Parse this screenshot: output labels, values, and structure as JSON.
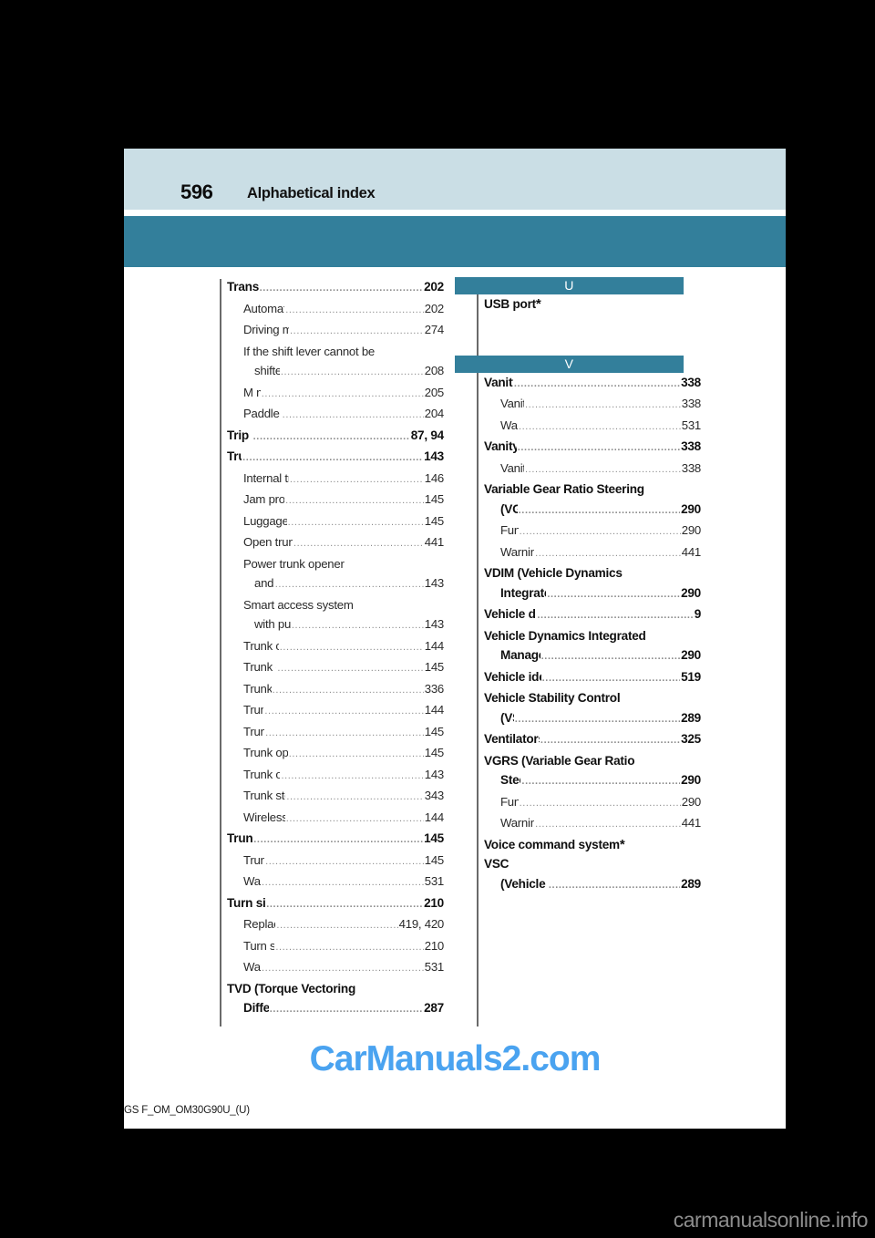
{
  "header": {
    "page_number": "596",
    "title": "Alphabetical index",
    "band_color": "#cadee5",
    "rule_color": "#337f9b"
  },
  "footer": {
    "code": "GS F_OM_OM30G90U_(U)"
  },
  "watermarks": {
    "main": "CarManuals2.com",
    "main_color": "#4aa3f0",
    "corner": "carmanualsonline.info",
    "corner_color": "#8d8d8d"
  },
  "columns": [
    {
      "name": "left-column",
      "blocks": [
        {
          "type": "entries",
          "entries": [
            {
              "level": 0,
              "label": "Transmission",
              "page": "202"
            },
            {
              "level": 1,
              "label": "Automatic transmission",
              "page": "202"
            },
            {
              "level": 1,
              "label": "Driving mode select switch",
              "page": "274"
            },
            {
              "level": 1,
              "label": "If the shift lever cannot be",
              "page": ""
            },
            {
              "level": 1,
              "cont": true,
              "label": "shifted from P",
              "page": "208"
            },
            {
              "level": 1,
              "label": "M mode",
              "page": "205"
            },
            {
              "level": 1,
              "label": "Paddle shift switches",
              "page": "204"
            },
            {
              "level": 0,
              "label": "Trip meters",
              "page": "87, 94"
            },
            {
              "level": 0,
              "label": "Trunk",
              "page": "143"
            },
            {
              "level": 1,
              "label": "Internal trunk release lever",
              "page": "146"
            },
            {
              "level": 1,
              "label": "Jam protection function",
              "page": "145"
            },
            {
              "level": 1,
              "label": "Luggage security system",
              "page": "145"
            },
            {
              "level": 1,
              "label": "Open trunk warning message",
              "page": "441"
            },
            {
              "level": 1,
              "label": "Power trunk opener",
              "page": ""
            },
            {
              "level": 1,
              "cont": true,
              "label": "and closer",
              "page": "143"
            },
            {
              "level": 1,
              "label": "Smart access system",
              "page": ""
            },
            {
              "level": 1,
              "cont": true,
              "label": "with push-button start",
              "page": "143"
            },
            {
              "level": 1,
              "label": "Trunk closer switch",
              "page": "144"
            },
            {
              "level": 1,
              "label": "Trunk easy closer",
              "page": "145"
            },
            {
              "level": 1,
              "label": "Trunk features",
              "page": "336"
            },
            {
              "level": 1,
              "label": "Trunk grip",
              "page": "144"
            },
            {
              "level": 1,
              "label": "Trunk light",
              "page": "145"
            },
            {
              "level": 1,
              "label": "Trunk opener main switch",
              "page": "145"
            },
            {
              "level": 1,
              "label": "Trunk opener switch",
              "page": "143"
            },
            {
              "level": 1,
              "label": "Trunk storage extension",
              "page": "343"
            },
            {
              "level": 1,
              "label": "Wireless remote control",
              "page": "144"
            },
            {
              "level": 0,
              "label": "Trunk light",
              "page": "145"
            },
            {
              "level": 1,
              "label": "Trunk light",
              "page": "145"
            },
            {
              "level": 1,
              "label": "Wattage",
              "page": "531"
            },
            {
              "level": 0,
              "label": "Turn signal lights",
              "page": "210"
            },
            {
              "level": 1,
              "label": "Replacing light bulbs",
              "page": "419, 420"
            },
            {
              "level": 1,
              "label": "Turn signal lever",
              "page": "210"
            },
            {
              "level": 1,
              "label": "Wattage",
              "page": "531"
            },
            {
              "level": 0,
              "label": "TVD (Torque Vectoring",
              "page": ""
            },
            {
              "level": 0,
              "cont": true,
              "label": "Differential)",
              "page": "287"
            }
          ]
        }
      ]
    },
    {
      "name": "right-column",
      "blocks": [
        {
          "type": "letter",
          "letter": "U"
        },
        {
          "type": "entries",
          "entries": [
            {
              "level": 0,
              "label": "USB port",
              "page": "",
              "star": true
            }
          ]
        },
        {
          "type": "gap"
        },
        {
          "type": "letter",
          "letter": "V"
        },
        {
          "type": "entries",
          "entries": [
            {
              "level": 0,
              "label": "Vanity lights",
              "page": "338"
            },
            {
              "level": 1,
              "label": "Vanity lights",
              "page": "338"
            },
            {
              "level": 1,
              "label": "Wattage",
              "page": "531"
            },
            {
              "level": 0,
              "label": "Vanity mirrors",
              "page": "338"
            },
            {
              "level": 1,
              "label": "Vanity lights",
              "page": "338"
            },
            {
              "level": 0,
              "label": "Variable Gear Ratio Steering",
              "page": ""
            },
            {
              "level": 0,
              "cont": true,
              "label": "(VGRS)",
              "page": "290"
            },
            {
              "level": 1,
              "label": "Function",
              "page": "290"
            },
            {
              "level": 1,
              "label": "Warning message",
              "page": "441"
            },
            {
              "level": 0,
              "label": "VDIM (Vehicle Dynamics",
              "page": ""
            },
            {
              "level": 0,
              "cont": true,
              "label": "Integrated Management)",
              "page": "290"
            },
            {
              "level": 0,
              "label": "Vehicle data recordings",
              "page": "9"
            },
            {
              "level": 0,
              "label": "Vehicle Dynamics Integrated",
              "page": ""
            },
            {
              "level": 0,
              "cont": true,
              "label": "Management (VDIM)",
              "page": "290"
            },
            {
              "level": 0,
              "label": "Vehicle identification number",
              "page": "519"
            },
            {
              "level": 0,
              "label": "Vehicle Stability Control",
              "page": ""
            },
            {
              "level": 0,
              "cont": true,
              "label": "(VSC)",
              "page": "289"
            },
            {
              "level": 0,
              "label": "Ventilators (seat ventilators)",
              "page": "325"
            },
            {
              "level": 0,
              "label": "VGRS (Variable Gear Ratio",
              "page": ""
            },
            {
              "level": 0,
              "cont": true,
              "label": "Steering)",
              "page": "290"
            },
            {
              "level": 1,
              "label": "Function",
              "page": "290"
            },
            {
              "level": 1,
              "label": "Warning message",
              "page": "441"
            },
            {
              "level": 0,
              "label": "Voice command system",
              "page": "",
              "star": true
            },
            {
              "level": 0,
              "label": "VSC",
              "page": ""
            },
            {
              "level": 0,
              "cont": true,
              "label": "(Vehicle Stability Control)",
              "page": "289"
            }
          ]
        }
      ]
    }
  ]
}
